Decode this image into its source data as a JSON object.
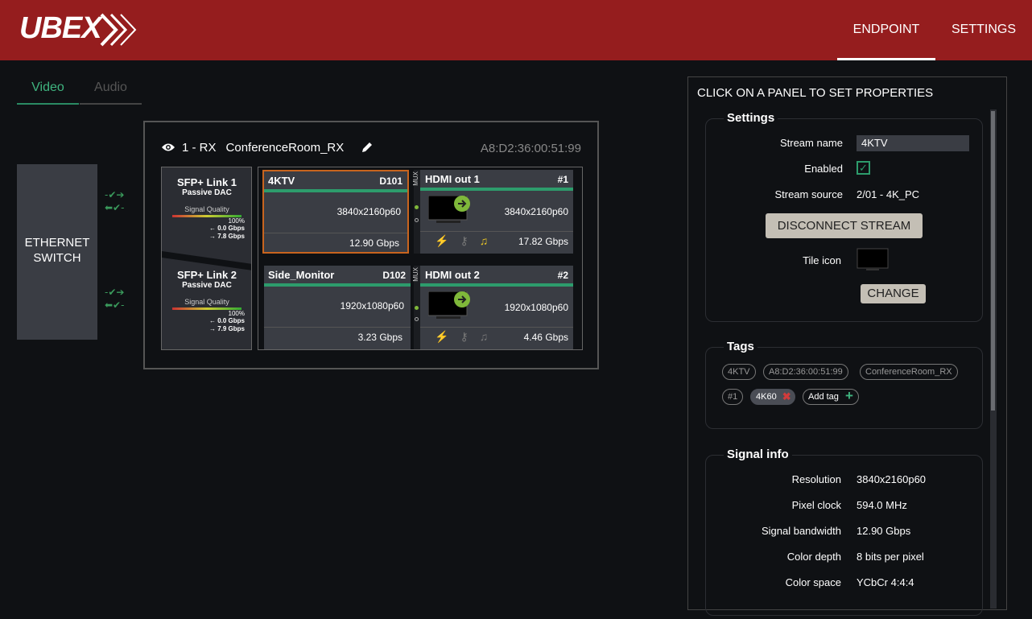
{
  "app": {
    "logo_text": "UBEX"
  },
  "nav": {
    "endpoint": "ENDPOINT",
    "settings": "SETTINGS"
  },
  "tabs": {
    "video": "Video",
    "audio": "Audio"
  },
  "ethernet": {
    "line1": "ETHERNET",
    "line2": "SWITCH"
  },
  "device": {
    "title": "1 - RX",
    "name": "ConferenceRoom_RX",
    "mac": "A8:D2:36:00:51:99",
    "links": [
      {
        "title": "SFP+ Link 1",
        "type": "Passive DAC",
        "quality_label": "Signal Quality",
        "quality": "100%",
        "rx": "0.0 Gbps",
        "tx": "7.8 Gbps"
      },
      {
        "title": "SFP+ Link 2",
        "type": "Passive DAC",
        "quality_label": "Signal Quality",
        "quality": "100%",
        "rx": "0.0 Gbps",
        "tx": "7.9 Gbps"
      }
    ],
    "streams": [
      {
        "name": "4KTV",
        "id": "D101",
        "res": "3840x2160p60",
        "bw": "12.90 Gbps"
      },
      {
        "name": "Side_Monitor",
        "id": "D102",
        "res": "1920x1080p60",
        "bw": "3.23 Gbps"
      }
    ],
    "outputs": [
      {
        "name": "HDMI out 1",
        "id": "#1",
        "res": "3840x2160p60",
        "bw": "17.82 Gbps",
        "mux": "MUX"
      },
      {
        "name": "HDMI out 2",
        "id": "#2",
        "res": "1920x1080p60",
        "bw": "4.46 Gbps",
        "mux": "MUX"
      }
    ]
  },
  "panel": {
    "title": "CLICK ON A PANEL TO SET PROPERTIES",
    "settings": {
      "heading": "Settings",
      "stream_name_label": "Stream name",
      "stream_name_value": "4KTV",
      "enabled_label": "Enabled",
      "stream_source_label": "Stream source",
      "stream_source_value": "2/01 - 4K_PC",
      "disconnect": "DISCONNECT STREAM",
      "tile_icon_label": "Tile icon",
      "change": "CHANGE"
    },
    "tags": {
      "heading": "Tags",
      "items": [
        "4KTV",
        "A8:D2:36:00:51:99",
        "ConferenceRoom_RX",
        "#1"
      ],
      "active": "4K60",
      "add": "Add tag"
    },
    "signal": {
      "heading": "Signal info",
      "rows": [
        {
          "k": "Resolution",
          "v": "3840x2160p60"
        },
        {
          "k": "Pixel clock",
          "v": "594.0 MHz"
        },
        {
          "k": "Signal bandwidth",
          "v": "12.90 Gbps"
        },
        {
          "k": "Color depth",
          "v": "8 bits per pixel"
        },
        {
          "k": "Color space",
          "v": "YCbCr 4:4:4"
        }
      ]
    }
  }
}
